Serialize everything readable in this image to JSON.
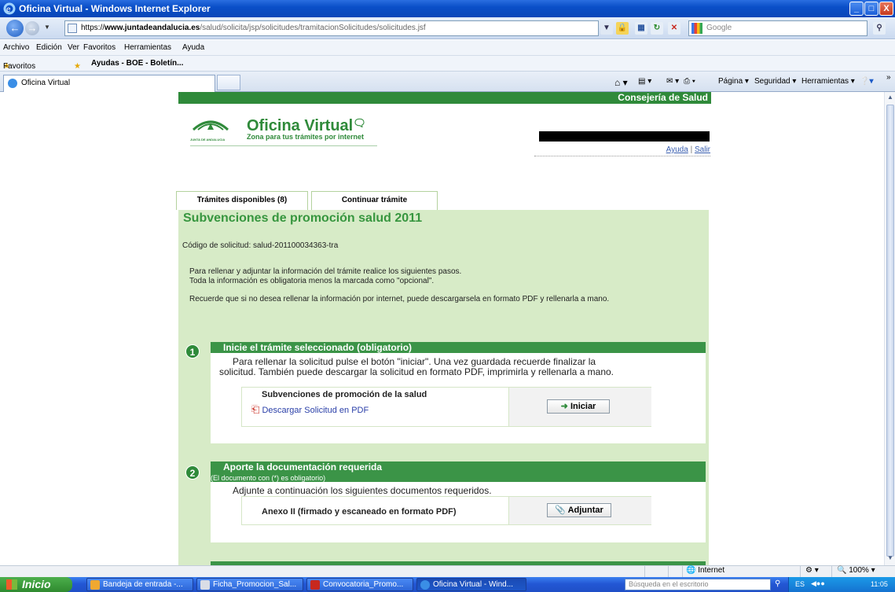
{
  "window": {
    "title": "Oficina Virtual - Windows Internet Explorer",
    "minimize": "_",
    "maximize": "□",
    "close": "X"
  },
  "addressbar": {
    "prefix": "https://",
    "host": "www.juntadeandalucia.es",
    "path": "/salud/solicita/jsp/solicitudes/tramitacionSolicitudes/solicitudes.jsf",
    "search_placeholder": "Google"
  },
  "menu": [
    "Archivo",
    "Edición",
    "Ver",
    "Favoritos",
    "Herramientas",
    "Ayuda"
  ],
  "favorites": {
    "label": "Favoritos",
    "item": "Ayudas - BOE - Boletín..."
  },
  "ie_tab": {
    "label": "Oficina Virtual",
    "commands": [
      "Página ▾",
      "Seguridad ▾",
      "Herramientas ▾"
    ]
  },
  "page": {
    "header_bar": "Consejería de Salud",
    "logo_org": "JUNTA DE ANDALUCIA",
    "logo_title": "Oficina Virtual",
    "logo_subtitle": "Zona para tus trámites por internet",
    "link_ayuda": "Ayuda",
    "link_sep": "|",
    "link_salir": "Salir",
    "tabs": [
      "Trámites disponibles (8)",
      "Continuar trámite"
    ],
    "title": "Subvenciones de promoción salud 2011",
    "codigo": "Código de solicitud:  salud-201100034363-tra",
    "intro1": "Para rellenar y adjuntar la información del trámite realice los siguientes pasos.",
    "intro2": "Toda la información es obligatoria menos la marcada como \"opcional\".",
    "intro3": "Recuerde que si no desea rellenar la información por internet, puede descargarsela en formato PDF y rellenarla a mano.",
    "step1": {
      "num": "1",
      "heading": "Inicie el trámite seleccionado (obligatorio)",
      "text1": "Para rellenar la solicitud pulse el botón \"iniciar\". Una vez guardada recuerde finalizar la",
      "text2": "solicitud. También puede descargar la solicitud en formato PDF, imprimirla y rellenarla a mano.",
      "form_name": "Subvenciones de promoción de la salud",
      "download": "Descargar Solicitud en PDF",
      "button": "Iniciar"
    },
    "step2": {
      "num": "2",
      "heading": "Aporte la documentación requerida",
      "subheading": "(El documento con (*) es obligatorio)",
      "text": "Adjunte a continuación los siguientes documentos requeridos.",
      "doc": "Anexo II (firmado y escaneado en formato PDF)",
      "button": "Adjuntar"
    }
  },
  "status": {
    "zone": "Internet",
    "zoom": "100%"
  },
  "taskbar": {
    "start": "Inicio",
    "items": [
      "Bandeja de entrada -...",
      "Ficha_Promocion_Sal...",
      "Convocatoria_Promo...",
      "Oficina Virtual - Wind..."
    ],
    "search": "Búsqueda en el escritorio",
    "lang": "ES",
    "clock": "11:05"
  }
}
